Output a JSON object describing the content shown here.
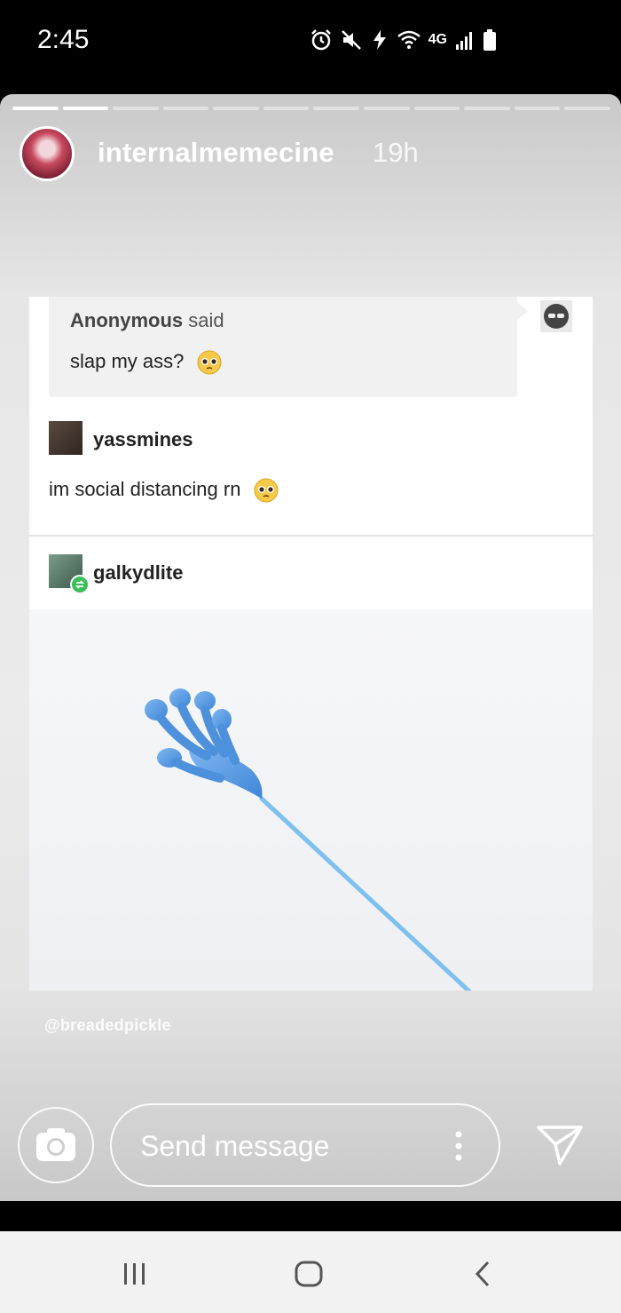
{
  "status_bar": {
    "time": "2:45",
    "network_label": "4G",
    "icons": [
      "alarm-icon",
      "mute-icon",
      "data-saver-icon",
      "wifi-icon",
      "signal-icon",
      "battery-icon"
    ]
  },
  "story": {
    "progress_segments_total": 12,
    "progress_segments_done": 2,
    "username": "internalmemecine",
    "time_ago": "19h",
    "watermark": "@breadedpickle",
    "post": {
      "asker_name": "Anonymous",
      "asker_said": "said",
      "question": "slap my ass?",
      "reply_user": "yassmines",
      "reply_text": "im social distancing rn",
      "reblog_user": "galkydlite",
      "image_subject": "blue sticky hand toy"
    }
  },
  "composer": {
    "placeholder": "Send message"
  },
  "nav_bar": {
    "buttons": [
      "recent-apps-button",
      "home-button",
      "back-button"
    ]
  },
  "colors": {
    "story_bg": "#e6e6e6",
    "post_bg": "#ffffff",
    "ask_box_bg": "#f1f1f1",
    "reblog_badge": "#3cbf5a",
    "toy_blue": "#5b9ee6"
  }
}
